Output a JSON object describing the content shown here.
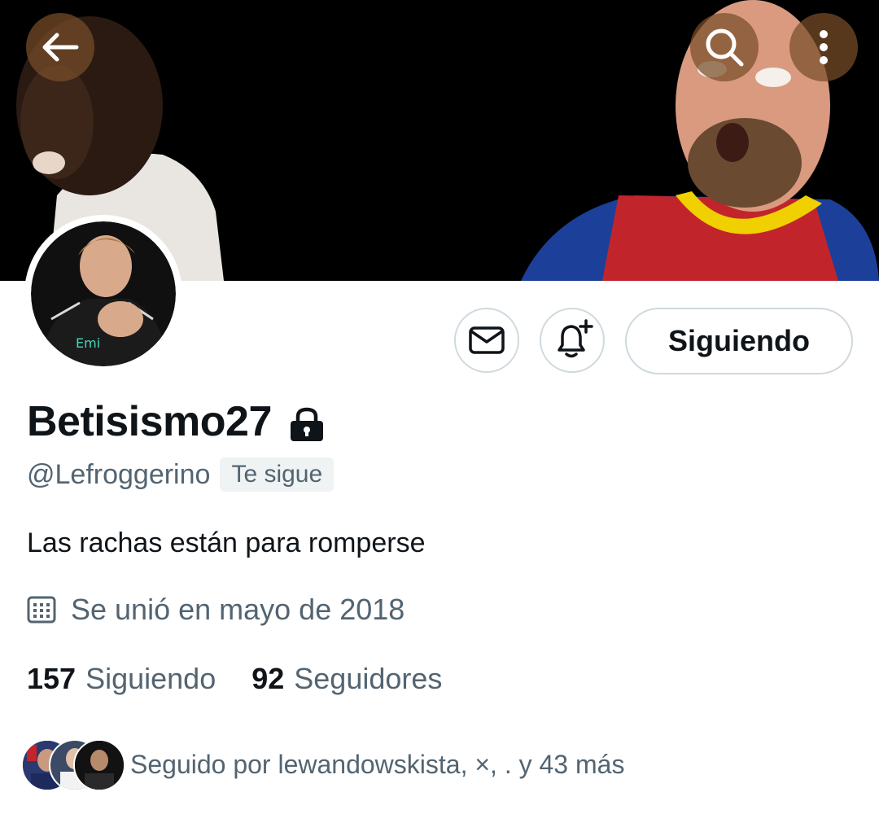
{
  "header": {
    "back_icon": "arrow-left-icon",
    "search_icon": "search-icon",
    "more_icon": "more-vertical-icon"
  },
  "profile": {
    "display_name": "Betisismo27",
    "protected_icon": "lock-icon",
    "handle": "@Lefroggerino",
    "follows_you_label": "Te sigue",
    "bio": "Las rachas están para romperse",
    "joined": "Se unió en mayo de 2018",
    "following_count": "157",
    "following_label": "Siguiendo",
    "followers_count": "92",
    "followers_label": "Seguidores",
    "followed_by": "Seguido por lewandowskista, ×, . y 43 más"
  },
  "actions": {
    "message_icon": "envelope-icon",
    "notify_icon": "bell-plus-icon",
    "follow_button_label": "Siguiendo"
  },
  "colors": {
    "text_primary": "#0f1419",
    "text_secondary": "#536471",
    "border": "#cfd9de",
    "badge_bg": "#eff3f4"
  }
}
